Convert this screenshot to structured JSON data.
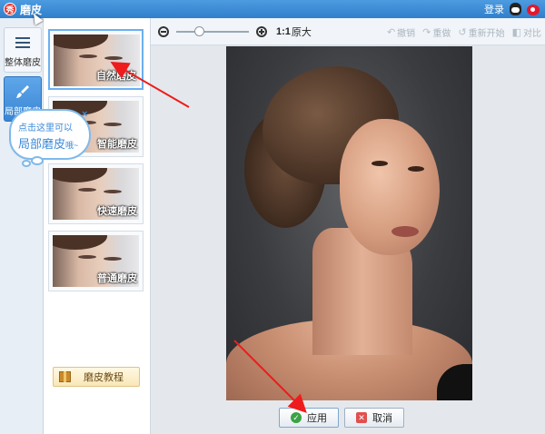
{
  "window": {
    "title": "磨皮",
    "logo_text": "秀",
    "login_label": "登录"
  },
  "tabs": [
    {
      "label": "整体磨皮",
      "icon": "sliders-icon",
      "active": false
    },
    {
      "label": "局部磨皮",
      "icon": "brush-icon",
      "active": true
    }
  ],
  "presets": [
    {
      "label": "自然磨皮",
      "selected": true
    },
    {
      "label": "智能磨皮",
      "selected": false
    },
    {
      "label": "快速磨皮",
      "selected": false
    },
    {
      "label": "普通磨皮",
      "selected": false
    }
  ],
  "tutorial": {
    "label": "磨皮教程",
    "icon": "box-icon"
  },
  "bubble": {
    "line1": "点击这里可以",
    "line2": "局部磨皮",
    "line2_suffix": "哦~",
    "close": "×"
  },
  "toolbar": {
    "zoom_ratio": "1:1",
    "original_size": "原大",
    "undo": "撤销",
    "redo": "重做",
    "restart": "重新开始",
    "compare": "对比"
  },
  "actions": {
    "apply": "应用",
    "cancel": "取消"
  },
  "colors": {
    "titlebar": "#2f7fcc",
    "accent": "#3a86d3",
    "arrow": "#ee1c1c"
  }
}
